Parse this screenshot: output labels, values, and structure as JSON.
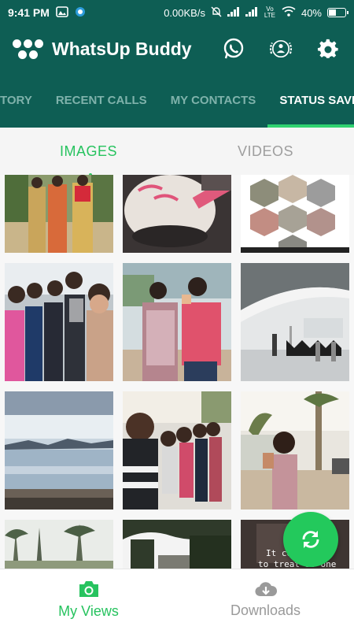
{
  "status_bar": {
    "time": "9:41 PM",
    "network_speed": "0.00KB/s",
    "volte": "Vo LTE",
    "battery": "40%"
  },
  "app_bar": {
    "title": "WhatsUp Buddy",
    "icons": [
      "whatsapp-icon",
      "badge-icon",
      "gear-icon"
    ]
  },
  "tabs": [
    {
      "label": "TORY",
      "active": false
    },
    {
      "label": "RECENT CALLS",
      "active": false
    },
    {
      "label": "MY CONTACTS",
      "active": false
    },
    {
      "label": "STATUS SAVER",
      "active": true
    }
  ],
  "subtabs": [
    {
      "label": "IMAGES",
      "active": true
    },
    {
      "label": "VIDEOS",
      "active": false
    }
  ],
  "grid": {
    "overlay_text_line1": "It co",
    "overlay_text_line2": "to treat so   one"
  },
  "bottom_nav": [
    {
      "label": "My Views",
      "icon": "camera-icon",
      "active": true
    },
    {
      "label": "Downloads",
      "icon": "cloud-download-icon",
      "active": false
    }
  ],
  "fab": {
    "icon": "refresh-icon"
  },
  "colors": {
    "primary": "#0e5e54",
    "accent": "#27c35f",
    "fab": "#23c95c"
  }
}
